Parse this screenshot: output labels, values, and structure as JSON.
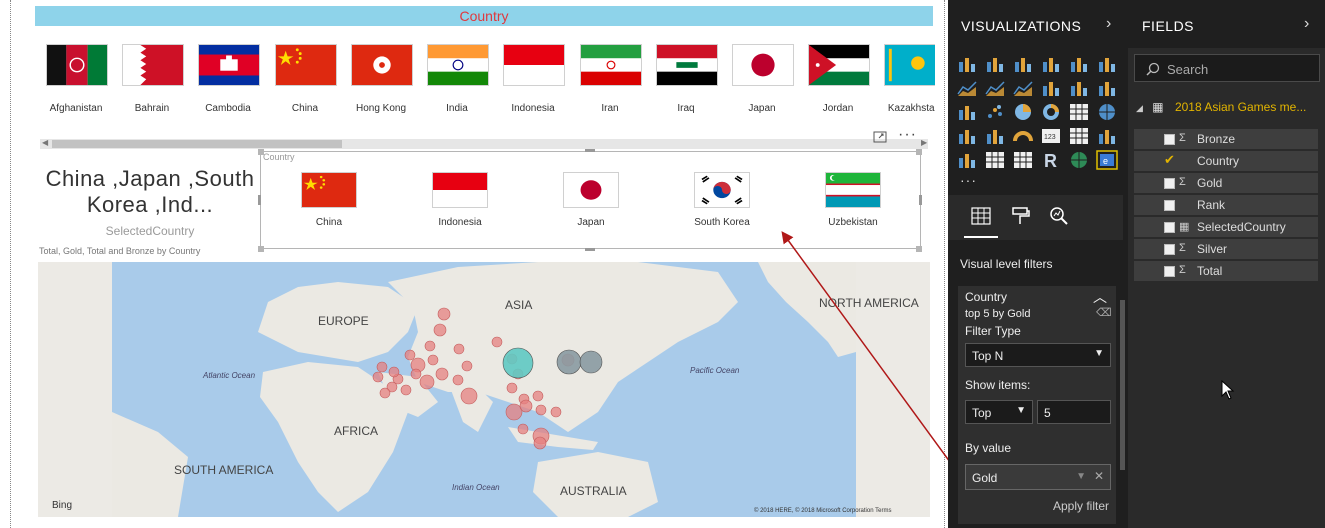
{
  "slicer_header": "Country",
  "flag_strip": [
    {
      "label": "Afghanistan",
      "flag": "afghanistan-flag"
    },
    {
      "label": "Bahrain",
      "flag": "bahrain-flag"
    },
    {
      "label": "Cambodia",
      "flag": "cambodia-flag"
    },
    {
      "label": "China",
      "flag": "china-flag"
    },
    {
      "label": "Hong Kong",
      "flag": "hong-kong-flag"
    },
    {
      "label": "India",
      "flag": "india-flag"
    },
    {
      "label": "Indonesia",
      "flag": "indonesia-flag"
    },
    {
      "label": "Iran",
      "flag": "iran-flag"
    },
    {
      "label": "Iraq",
      "flag": "iraq-flag"
    },
    {
      "label": "Japan",
      "flag": "japan-flag"
    },
    {
      "label": "Jordan",
      "flag": "jordan-flag"
    },
    {
      "label": "Kazakhstan",
      "flag": "kazakhstan-flag"
    }
  ],
  "card": {
    "value": "China ,Japan ,South Korea ,Ind...",
    "label": "SelectedCountry"
  },
  "map": {
    "title": "Total, Gold, Total and Bronze by Country",
    "labels": {
      "asia": "ASIA",
      "europe": "EUROPE",
      "africa": "AFRICA",
      "north_america": "NORTH AMERICA",
      "south_america": "SOUTH AMERICA",
      "australia": "AUSTRALIA",
      "atlantic": "Atlantic Ocean",
      "pacific": "Pacific Ocean",
      "indian": "Indian Ocean"
    },
    "bing": "Bing",
    "copyright": "© 2018 HERE, © 2018 Microsoft Corporation Terms",
    "accent_bubble": "#e58080",
    "highlight_bubble": "#5fc9c2",
    "gray_bubble": "#8a9aa1"
  },
  "selected_slicer": {
    "caption": "Country",
    "items": [
      {
        "label": "China",
        "flag": "china-flag"
      },
      {
        "label": "Indonesia",
        "flag": "indonesia-flag"
      },
      {
        "label": "Japan",
        "flag": "japan-flag"
      },
      {
        "label": "South Korea",
        "flag": "south-korea-flag"
      },
      {
        "label": "Uzbekistan",
        "flag": "uzbekistan-flag"
      }
    ]
  },
  "visualizations": {
    "title": "VISUALIZATIONS",
    "filters_heading": "Visual level filters",
    "filter": {
      "field": "Country",
      "summary": "top 5 by Gold",
      "filter_type_label": "Filter Type",
      "filter_type_value": "Top N",
      "show_items_label": "Show items:",
      "show_items_direction": "Top",
      "show_items_count": "5",
      "by_value_label": "By value",
      "by_value_field": "Gold",
      "apply_label": "Apply filter"
    }
  },
  "fields": {
    "title": "FIELDS",
    "search_placeholder": "Search",
    "table_name": "2018 Asian Games me...",
    "items": [
      {
        "name": "Bronze",
        "sigma": "Σ",
        "checked": false
      },
      {
        "name": "Country",
        "sigma": "",
        "checked": true
      },
      {
        "name": "Gold",
        "sigma": "Σ",
        "checked": false
      },
      {
        "name": "Rank",
        "sigma": "",
        "checked": false
      },
      {
        "name": "SelectedCountry",
        "sigma": "▦",
        "checked": false
      },
      {
        "name": "Silver",
        "sigma": "Σ",
        "checked": false
      },
      {
        "name": "Total",
        "sigma": "Σ",
        "checked": false
      }
    ]
  }
}
